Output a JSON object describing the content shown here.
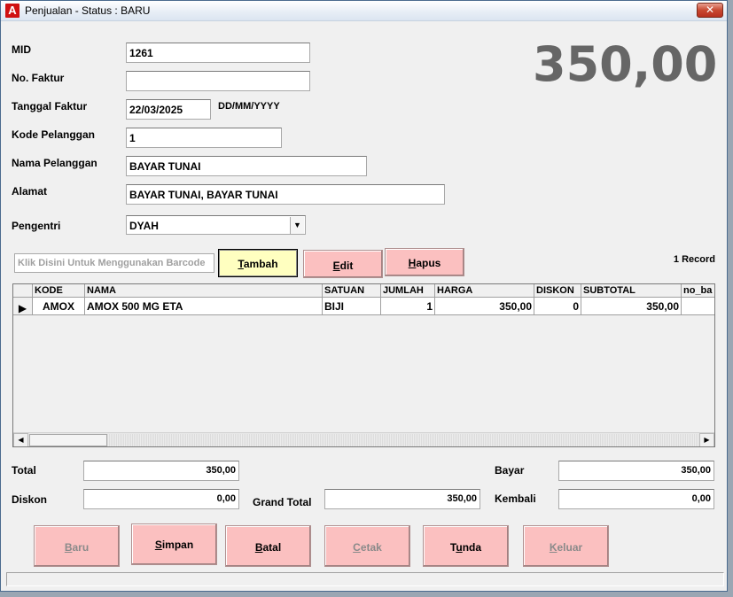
{
  "window": {
    "title": "Penjualan - Status : BARU",
    "close_glyph": "✕",
    "icon_letter": "A"
  },
  "form": {
    "mid_label": "MID",
    "mid_value": "1261",
    "faktur_label": "No. Faktur",
    "faktur_value": "",
    "tanggal_label": "Tanggal Faktur",
    "tanggal_value": "22/03/2025",
    "tanggal_format": "DD/MM/YYYY",
    "kode_pel_label": "Kode Pelanggan",
    "kode_pel_value": "1",
    "nama_pel_label": "Nama Pelanggan",
    "nama_pel_value": "BAYAR TUNAI",
    "alamat_label": "Alamat",
    "alamat_value": "BAYAR TUNAI, BAYAR TUNAI",
    "pengentri_label": "Pengentri",
    "pengentri_value": "DYAH"
  },
  "big_total": "350,00",
  "toolbar": {
    "barcode_placeholder": "Klik Disini Untuk Menggunakan Barcode",
    "tambah_pre": "",
    "tambah_key": "T",
    "tambah_post": "ambah",
    "edit_pre": "",
    "edit_key": "E",
    "edit_post": "dit",
    "hapus_pre": "",
    "hapus_key": "H",
    "hapus_post": "apus",
    "record_count": "1 Record"
  },
  "grid": {
    "columns": [
      "KODE",
      "NAMA",
      "SATUAN",
      "JUMLAH",
      "HARGA",
      "DISKON",
      "SUBTOTAL",
      "no_ba"
    ],
    "rows": [
      {
        "kode": "AMOX",
        "nama": "AMOX 500 MG ETA",
        "satuan": "BIJI",
        "jumlah": "1",
        "harga": "350,00",
        "diskon": "0",
        "subtotal": "350,00",
        "no_ba": ""
      }
    ]
  },
  "totals": {
    "total_label": "Total",
    "total_value": "350,00",
    "diskon_label": "Diskon",
    "diskon_value": "0,00",
    "grand_label": "Grand Total",
    "grand_value": "350,00",
    "bayar_label": "Bayar",
    "bayar_value": "350,00",
    "kembali_label": "Kembali",
    "kembali_value": "0,00"
  },
  "actions": {
    "baru_key": "B",
    "baru_post": "aru",
    "simpan_key": "S",
    "simpan_post": "impan",
    "batal_key": "B",
    "batal_post": "atal",
    "cetak_key": "C",
    "cetak_post": "etak",
    "tunda_pre": "T",
    "tunda_key": "u",
    "tunda_post": "nda",
    "keluar_key": "K",
    "keluar_post": "eluar"
  },
  "colors": {
    "button_pink": "#fbc0c0",
    "button_yellow": "#ffffc0",
    "total_gray": "#666666"
  }
}
